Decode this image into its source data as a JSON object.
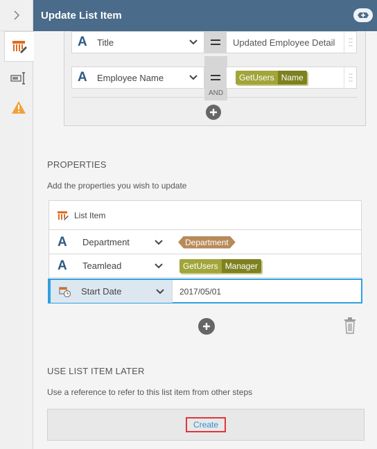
{
  "header": {
    "title": "Update List Item"
  },
  "rail": {
    "items": [
      {
        "icon": "list-item-edit-icon",
        "active": true
      },
      {
        "icon": "textbox-icon",
        "active": false
      },
      {
        "icon": "warning-icon",
        "active": false
      }
    ]
  },
  "criteria": {
    "rows": [
      {
        "field": "Title",
        "operator": "=",
        "value": "Updated Employee Detail"
      },
      {
        "field": "Employee Name",
        "operator": "=",
        "token": {
          "source": "GetUsers",
          "field": "Name"
        }
      }
    ],
    "join": "AND"
  },
  "properties": {
    "title": "PROPERTIES",
    "description": "Add the properties you wish to update",
    "header_label": "List Item",
    "rows": [
      {
        "field": "Department",
        "tag": "Department"
      },
      {
        "field": "Teamlead",
        "token": {
          "source": "GetUsers",
          "field": "Manager"
        }
      },
      {
        "field": "Start Date",
        "value": "2017/05/01"
      }
    ]
  },
  "later": {
    "title": "USE LIST ITEM LATER",
    "description": "Use a reference to refer to this list item from other steps",
    "create_label": "Create"
  },
  "colors": {
    "header_bg": "#4a6b8a",
    "accent_blue": "#2f9fe0",
    "token_light": "#a1a53a",
    "token_dark": "#7d8120",
    "tag_brown": "#b88a5a",
    "highlight_red": "#e0363c"
  }
}
